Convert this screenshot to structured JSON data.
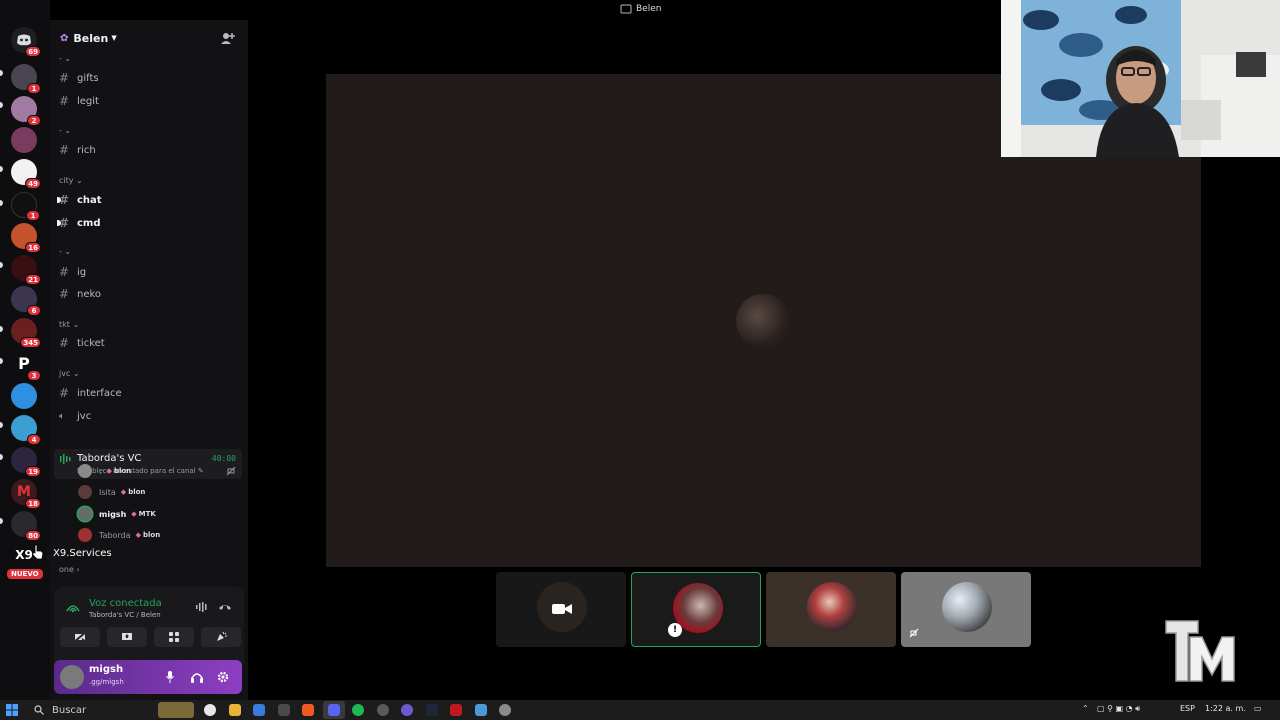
{
  "window": {
    "title": "Belen"
  },
  "rail": {
    "servers": [
      {
        "name": "direct-messages",
        "badge": "69",
        "color": "#1e1f22"
      },
      {
        "name": "server-1",
        "badge": "1",
        "color": "#4a4550"
      },
      {
        "name": "server-2",
        "badge": "2",
        "color": "#a07aa0"
      },
      {
        "name": "server-3",
        "badge": "",
        "color": "#7a3b5e"
      },
      {
        "name": "server-4",
        "badge": "49",
        "color": "#f2f2f2"
      },
      {
        "name": "server-5",
        "badge": "1",
        "color": "#101010"
      },
      {
        "name": "server-6",
        "badge": "16",
        "color": "#c4522d"
      },
      {
        "name": "server-7",
        "badge": "21",
        "color": "#3a0f12"
      },
      {
        "name": "server-8",
        "badge": "6",
        "color": "#3d3550"
      },
      {
        "name": "server-9",
        "badge": "345",
        "color": "#6b2020"
      },
      {
        "name": "server-10",
        "badge": "3",
        "color": "#0e0e10"
      },
      {
        "name": "server-11",
        "badge": "",
        "color": "#2f8fe0"
      },
      {
        "name": "server-12",
        "badge": "4",
        "color": "#3b9fd1"
      },
      {
        "name": "server-13",
        "badge": "19",
        "color": "#2b2540"
      },
      {
        "name": "server-14",
        "badge": "18",
        "color": "#3a1a1d"
      },
      {
        "name": "server-15",
        "badge": "80",
        "color": "#2a2a2e"
      },
      {
        "name": "server-x9",
        "badge": "",
        "color": "#0e0e10"
      }
    ],
    "nuevo_label": "NUEVO",
    "tooltip": "X9.Services",
    "x9_text": "X9"
  },
  "guild": {
    "name": "Belen"
  },
  "categories": [
    {
      "label": "-"
    },
    {
      "label": "-"
    },
    {
      "label": "city"
    },
    {
      "label": "-"
    },
    {
      "label": "tkt"
    },
    {
      "label": "jvc"
    },
    {
      "label": "one"
    }
  ],
  "channels": [
    {
      "name": "gifts",
      "unread": false
    },
    {
      "name": "legit",
      "unread": false
    },
    {
      "name": "rich",
      "unread": false
    },
    {
      "name": "chat",
      "unread": true
    },
    {
      "name": "cmd",
      "unread": true
    },
    {
      "name": "ig",
      "unread": false
    },
    {
      "name": "neko",
      "unread": false
    },
    {
      "name": "ticket",
      "unread": false
    },
    {
      "name": "interface",
      "unread": false
    },
    {
      "name": "jvc",
      "unread": false,
      "voice": true
    }
  ],
  "voice_channel": {
    "name": "Taborda's VC",
    "timer": "40:00",
    "status_placeholder": "Establece un estado para el canal",
    "members": [
      {
        "name": ".",
        "tag": "blon",
        "speaking": false,
        "color": "#8a8a8a"
      },
      {
        "name": "Isita",
        "tag": "blon",
        "speaking": false,
        "color": "#5a3a3a"
      },
      {
        "name": "migsh",
        "tag": "MTK",
        "speaking": true,
        "color": "#6a6a6a"
      },
      {
        "name": "Taborda",
        "tag": "blon",
        "speaking": false,
        "color": "#a03030"
      }
    ]
  },
  "voice_panel": {
    "status": "Voz conectada",
    "location": "Taborda's VC / Belen"
  },
  "user": {
    "name": "migsh",
    "status": ".gg/migsh"
  },
  "stage": {
    "tiles": [
      {
        "name": "camera-off-tile",
        "color": "#181818",
        "active": false
      },
      {
        "name": "tile-taborda",
        "color": "#1a1a1a",
        "active": true
      },
      {
        "name": "tile-isita",
        "color": "#3b3128",
        "active": false
      },
      {
        "name": "tile-migsh",
        "color": "#787878",
        "active": false
      }
    ]
  },
  "taskbar": {
    "search": "Buscar",
    "lang": "ESP",
    "time": "1:22 a. m."
  },
  "colors": {
    "accent": "#5865f2",
    "connected": "#23a55a",
    "badge": "#e0323b",
    "user_panel": "#8d3fc2"
  }
}
